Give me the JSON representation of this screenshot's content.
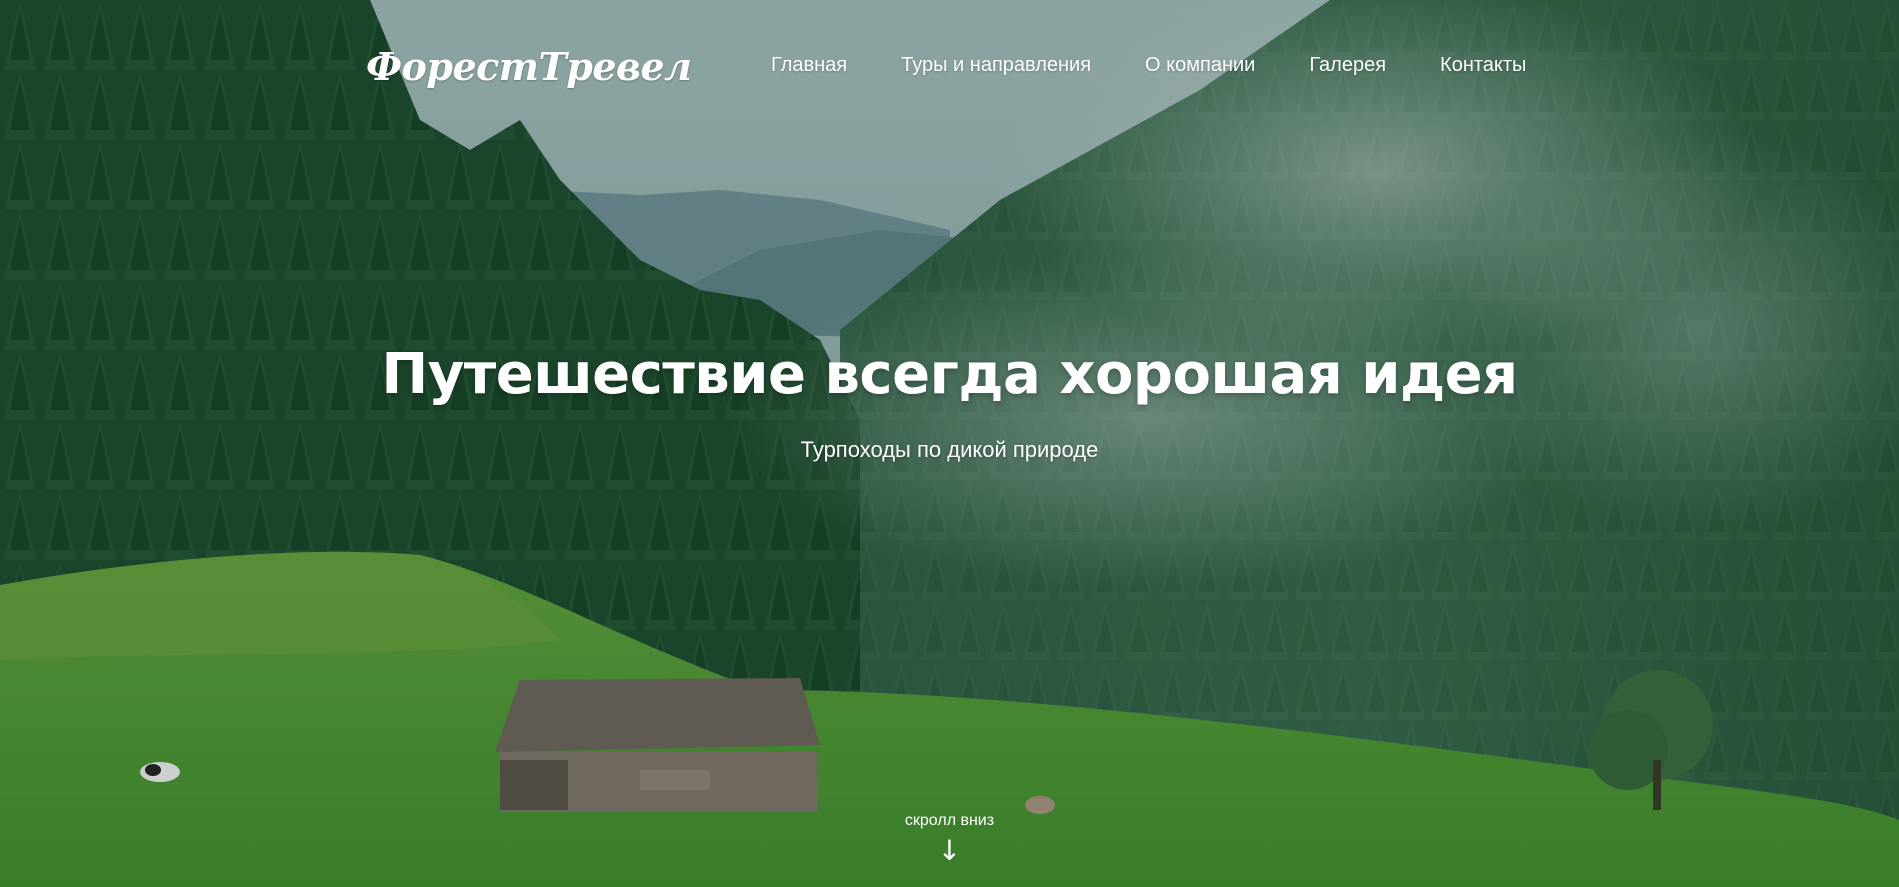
{
  "brand": {
    "logo_text": "ФорестТревел"
  },
  "nav": {
    "items": [
      {
        "label": "Главная"
      },
      {
        "label": "Туры и направления"
      },
      {
        "label": "О компании"
      },
      {
        "label": "Галерея"
      },
      {
        "label": "Контакты"
      }
    ]
  },
  "hero": {
    "headline": "Путешествие всегда хорошая идея",
    "subtitle": "Турпоходы по дикой природе",
    "scroll_label": "скролл вниз",
    "scroll_arrow": "↓"
  },
  "colors": {
    "sky": "#8fa9a8",
    "forest_dark": "#1f4a2c",
    "forest_mid": "#2f6040",
    "meadow": "#4f9a35",
    "text": "#ffffff"
  }
}
